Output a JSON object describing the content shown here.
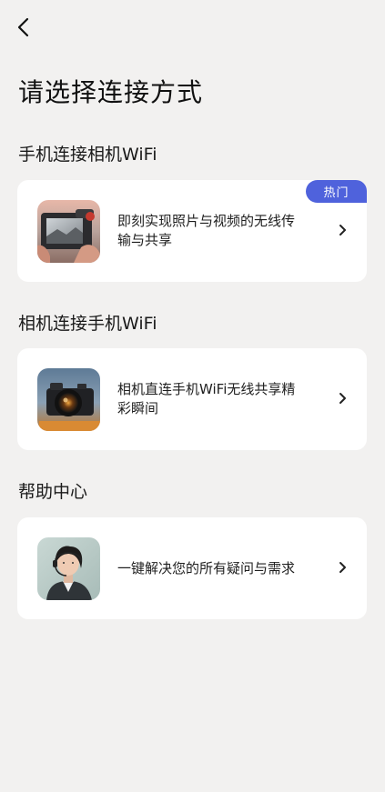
{
  "header": {
    "back_icon": "chevron-left-icon",
    "title": "请选择连接方式"
  },
  "sections": [
    {
      "title": "手机连接相机WiFi",
      "card": {
        "image": "camera-viewfinder-photo",
        "description": "即刻实现照片与视频的无线传输与共享",
        "badge": "热门"
      }
    },
    {
      "title": "相机连接手机WiFi",
      "card": {
        "image": "vintage-camera-photo",
        "description": "相机直连手机WiFi无线共享精彩瞬间"
      }
    },
    {
      "title": "帮助中心",
      "card": {
        "image": "support-agent-headset-photo",
        "description": "一键解决您的所有疑问与需求"
      }
    }
  ],
  "colors": {
    "background": "#f2f1f0",
    "card": "#ffffff",
    "badge": "#4f62dc"
  }
}
